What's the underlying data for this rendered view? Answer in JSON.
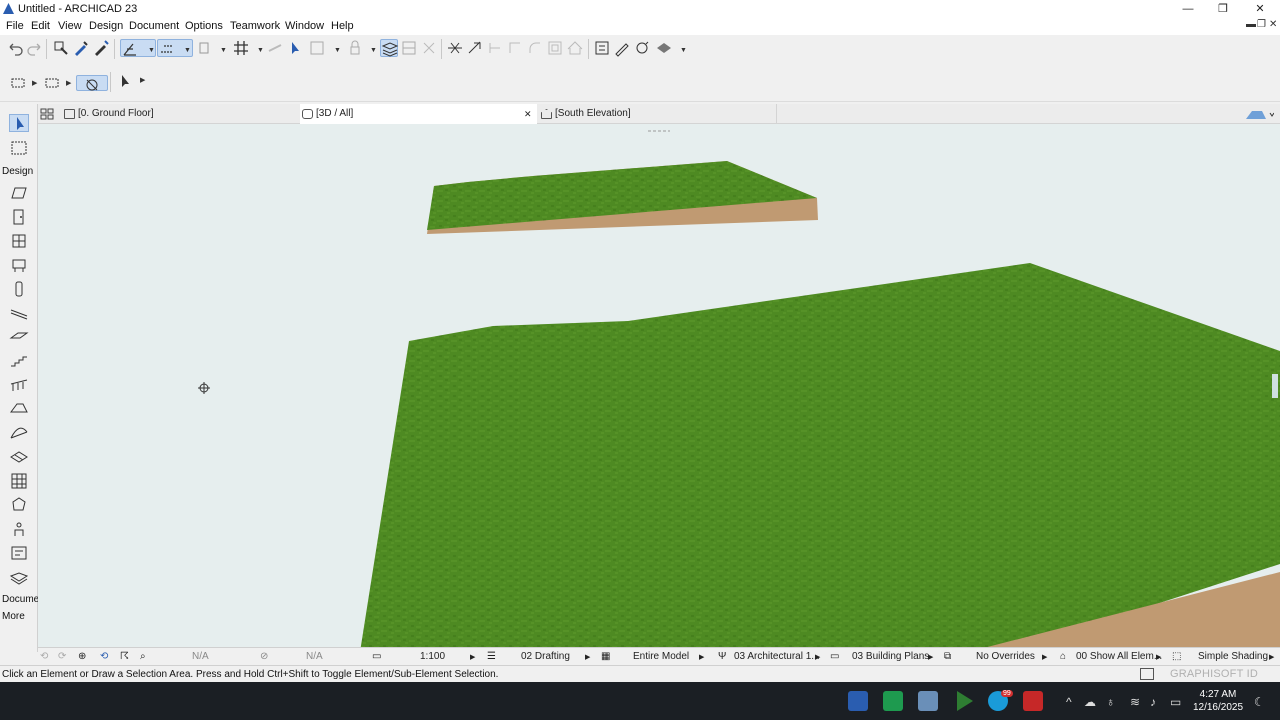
{
  "window": {
    "title": "Untitled - ARCHICAD 23",
    "minimize_glyph": "—",
    "restore_glyph": "❐",
    "close_glyph": "✕"
  },
  "menubar": {
    "items": [
      "File",
      "Edit",
      "View",
      "Design",
      "Document",
      "Options",
      "Teamwork",
      "Window",
      "Help"
    ],
    "doc_controls": [
      "▬",
      "❐",
      "✕"
    ]
  },
  "tabs": [
    {
      "label": "[0. Ground Floor]",
      "icon": "floor-plan-icon"
    },
    {
      "label": "[3D / All]",
      "icon": "3d-window-icon",
      "close": "✕"
    },
    {
      "label": "[South Elevation]",
      "icon": "elevation-icon"
    }
  ],
  "toolbox": {
    "design_label": "Design",
    "document_label": "Docume",
    "more_label": "More",
    "tools": [
      "arrow-tool-icon",
      "marquee-tool-icon",
      "wall-tool-icon",
      "door-tool-icon",
      "window-tool-icon",
      "object-tool-icon",
      "column-tool-icon",
      "beam-tool-icon",
      "slab-tool-icon",
      "stair-tool-icon",
      "railing-tool-icon",
      "roof-tool-icon",
      "shell-tool-icon",
      "mesh-tool-icon",
      "curtain-wall-tool-icon",
      "morph-tool-icon",
      "zone-tool-icon",
      "label-tool-icon",
      "terrain-tool-icon"
    ]
  },
  "navbar": {
    "na_1": "N/A",
    "na_2": "N/A",
    "scale": "1:100",
    "layer_combo": "02 Drafting",
    "model_view": "Entire Model",
    "pen_set": "03 Architectural 1...",
    "mvo": "03 Building Plans",
    "overrides": "No Overrides",
    "renovation": "00 Show All Elem...",
    "shading": "Simple Shading"
  },
  "status": {
    "message": "Click an Element or Draw a Selection Area. Press and Hold Ctrl+Shift to Toggle Element/Sub-Element Selection.",
    "brand": "GRAPHISOFT ID"
  },
  "taskbar": {
    "time": "4:27 AM",
    "date": "12/16/2025",
    "badge": "99",
    "tray_caret": "^"
  },
  "colors": {
    "grass": "#4e8a22",
    "grass_dark": "#3f7518",
    "soil": "#c09a72",
    "sky": "#e6eeee",
    "accent": "#2a5db0"
  }
}
